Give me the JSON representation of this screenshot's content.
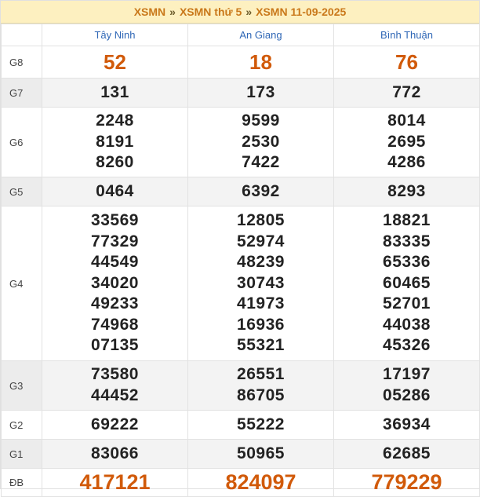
{
  "breadcrumb": {
    "items": [
      "XSMN",
      "XSMN thứ 5",
      "XSMN 11-09-2025"
    ],
    "separator": "»"
  },
  "provinces": [
    "Tây Ninh",
    "An Giang",
    "Bình Thuận"
  ],
  "prizes": [
    {
      "label": "G8",
      "values": [
        [
          "52"
        ],
        [
          "18"
        ],
        [
          "76"
        ]
      ]
    },
    {
      "label": "G7",
      "values": [
        [
          "131"
        ],
        [
          "173"
        ],
        [
          "772"
        ]
      ]
    },
    {
      "label": "G6",
      "values": [
        [
          "2248",
          "8191",
          "8260"
        ],
        [
          "9599",
          "2530",
          "7422"
        ],
        [
          "8014",
          "2695",
          "4286"
        ]
      ]
    },
    {
      "label": "G5",
      "values": [
        [
          "0464"
        ],
        [
          "6392"
        ],
        [
          "8293"
        ]
      ]
    },
    {
      "label": "G4",
      "values": [
        [
          "33569",
          "77329",
          "44549",
          "34020",
          "49233",
          "74968",
          "07135"
        ],
        [
          "12805",
          "52974",
          "48239",
          "30743",
          "41973",
          "16936",
          "55321"
        ],
        [
          "18821",
          "83335",
          "65336",
          "60465",
          "52701",
          "44038",
          "45326"
        ]
      ]
    },
    {
      "label": "G3",
      "values": [
        [
          "73580",
          "44452"
        ],
        [
          "26551",
          "86705"
        ],
        [
          "17197",
          "05286"
        ]
      ]
    },
    {
      "label": "G2",
      "values": [
        [
          "69222"
        ],
        [
          "55222"
        ],
        [
          "36934"
        ]
      ]
    },
    {
      "label": "G1",
      "values": [
        [
          "83066"
        ],
        [
          "50965"
        ],
        [
          "62685"
        ]
      ]
    },
    {
      "label": "ĐB",
      "values": [
        [
          "417121"
        ],
        [
          "824097"
        ],
        [
          "779229"
        ]
      ]
    }
  ],
  "colors": {
    "header_bg": "#fdf0c0",
    "accent": "#c9781a",
    "province": "#2f67b6",
    "highlight": "#d15a0a"
  }
}
